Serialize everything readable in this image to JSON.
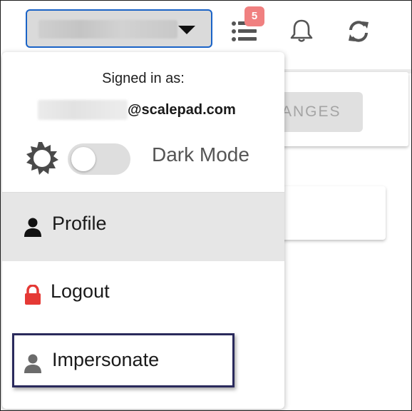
{
  "header": {
    "account_selector": {
      "value": ""
    },
    "tasks": {
      "badge_count": "5",
      "icon": "tasks-list-icon"
    },
    "notifications": {
      "icon": "bell-icon"
    },
    "sync": {
      "icon": "sync-icon"
    }
  },
  "background": {
    "partial_button_label": "ANGES"
  },
  "user_menu": {
    "signed_in_label": "Signed in as:",
    "email_domain": "@scalepad.com",
    "theme": {
      "icon": "sun-icon",
      "label": "Dark Mode",
      "enabled": false
    },
    "items": [
      {
        "label": "Profile",
        "icon": "user-icon",
        "color": "#111111",
        "highlighted": true
      },
      {
        "label": "Logout",
        "icon": "lock-icon",
        "color": "#e53935"
      },
      {
        "label": "Impersonate",
        "icon": "user-icon",
        "color": "#6b6b6b"
      }
    ]
  },
  "colors": {
    "accent": "#1a63c7",
    "badge": "#f08080",
    "logout_icon": "#e53935"
  }
}
